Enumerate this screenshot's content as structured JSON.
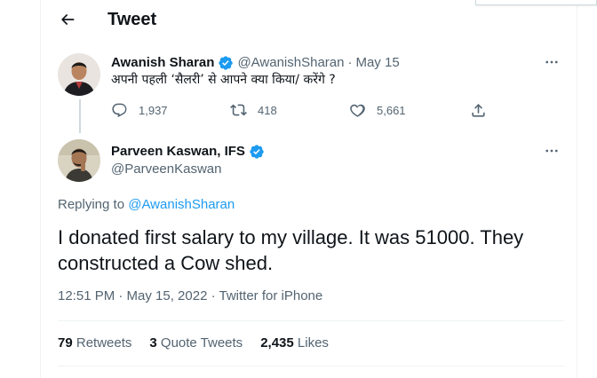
{
  "header": {
    "title": "Tweet",
    "back_icon": "arrow-left-icon"
  },
  "parent_tweet": {
    "author_name": "Awanish Sharan",
    "handle": "@AwanishSharan",
    "separator": "·",
    "date": "May 15",
    "text": "अपनी पहली ‘सैलरी’ से आपने क्या किया/ करेंगे ?",
    "actions": {
      "replies": "1,937",
      "retweets": "418",
      "likes": "5,661"
    }
  },
  "main_tweet": {
    "author_name": "Parveen Kaswan, IFS",
    "handle": "@ParveenKaswan",
    "replying_prefix": "Replying to ",
    "replying_to": "@AwanishSharan",
    "text": "I donated first salary to my village. It was 51000. They constructed a Cow shed.",
    "timestamp": "12:51 PM · May 15, 2022 · ",
    "source": "Twitter for iPhone"
  },
  "stats": {
    "retweets_count": "79",
    "retweets_label": "Retweets",
    "quotes_count": "3",
    "quotes_label": "Quote Tweets",
    "likes_count": "2,435",
    "likes_label": "Likes"
  },
  "colors": {
    "accent": "#1d9bf0",
    "text_primary": "#0f1419",
    "text_secondary": "#536471",
    "border": "#eff3f4"
  }
}
